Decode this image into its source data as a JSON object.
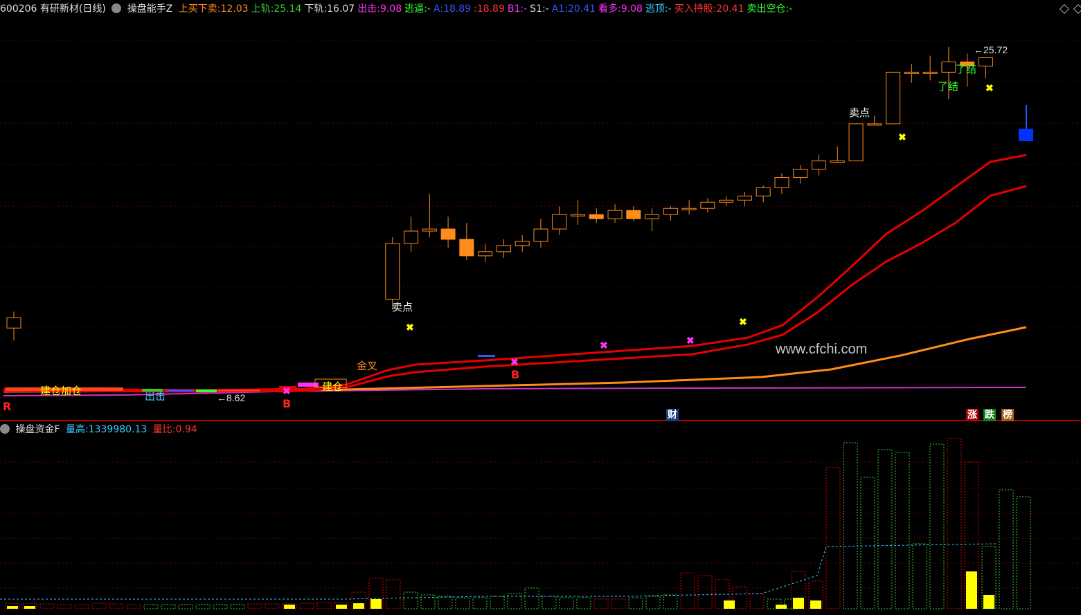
{
  "header": {
    "stock": "600206 有研新材(日线)",
    "indicator": "操盘能手Z",
    "fields": [
      {
        "label": "上买下卖:",
        "value": "12.03",
        "color": "#ff8c1a"
      },
      {
        "label": "上轨:",
        "value": "25.14",
        "color": "#33cc33"
      },
      {
        "label": "下轨:",
        "value": "16.07",
        "color": "#dddddd"
      },
      {
        "label": "出击:",
        "value": "9.08",
        "color": "#ff33ff"
      },
      {
        "label": "逃逼:",
        "value": "-",
        "color": "#33ff33"
      },
      {
        "label": "A:",
        "value": "18.89",
        "color": "#3355ff"
      },
      {
        "label": ":",
        "value": "18.89",
        "color": "#ff3333"
      },
      {
        "label": "B1:",
        "value": "-",
        "color": "#ff33ff"
      },
      {
        "label": "S1:",
        "value": "-",
        "color": "#dddddd"
      },
      {
        "label": "A1:",
        "value": "20.41",
        "color": "#3355ff"
      },
      {
        "label": "看多:",
        "value": "9.08",
        "color": "#ff33ff"
      },
      {
        "label": "逃顶:",
        "value": "-",
        "color": "#33ccff"
      },
      {
        "label": "买入持股:",
        "value": "20.41",
        "color": "#ff3333"
      },
      {
        "label": "卖出空仓:",
        "value": "-",
        "color": "#33ff33"
      }
    ]
  },
  "main_labels": {
    "sell_point_1": "卖点",
    "sell_point_2": "卖点",
    "golden_cross": "金叉",
    "attack": "出击",
    "build_position": "建仓加仓",
    "build_position_2": "建仓",
    "finish_1": "了结",
    "finish_2": "了结",
    "high_price": "25.72",
    "low_price": "8.62",
    "watermark": "www.cfchi.com",
    "b_marker": "B",
    "r_marker": "R"
  },
  "badges": {
    "finance": "财",
    "rise": "涨",
    "fall": "跌",
    "rank": "榜"
  },
  "sub_panel": {
    "indicator": "操盘资金F",
    "vol_high_label": "量高:",
    "vol_high_value": "1339980.13",
    "vol_ratio_label": "量比:",
    "vol_ratio_value": "0.94"
  },
  "colors": {
    "background": "#000000",
    "grid": "#8b0000",
    "up_candle": "#ff8c1a",
    "ma_red": "#e60000",
    "ma_orange": "#ff8c1a",
    "ma_purple": "#cc33cc",
    "vol_red": "#e60000",
    "vol_green": "#33cc33",
    "vol_yellow": "#ffff00"
  },
  "chart_data": {
    "type": "candlestick",
    "price_range": [
      8.62,
      25.72
    ],
    "candles": [
      {
        "o": 12.1,
        "h": 12.9,
        "l": 11.5,
        "c": 12.6
      },
      {
        "o": 13.5,
        "h": 16.5,
        "l": 13.0,
        "c": 16.2
      },
      {
        "o": 16.2,
        "h": 17.5,
        "l": 15.8,
        "c": 16.8
      },
      {
        "o": 16.8,
        "h": 18.6,
        "l": 16.5,
        "c": 16.9
      },
      {
        "o": 16.9,
        "h": 17.5,
        "l": 16.0,
        "c": 16.4
      },
      {
        "o": 16.4,
        "h": 17.2,
        "l": 15.4,
        "c": 15.6
      },
      {
        "o": 15.6,
        "h": 16.2,
        "l": 15.3,
        "c": 15.8
      },
      {
        "o": 15.8,
        "h": 16.4,
        "l": 15.5,
        "c": 16.1
      },
      {
        "o": 16.1,
        "h": 16.6,
        "l": 15.8,
        "c": 16.3
      },
      {
        "o": 16.3,
        "h": 17.4,
        "l": 16.0,
        "c": 16.9
      },
      {
        "o": 16.9,
        "h": 18.0,
        "l": 16.6,
        "c": 17.6
      },
      {
        "o": 17.6,
        "h": 18.3,
        "l": 17.1,
        "c": 17.6
      },
      {
        "o": 17.6,
        "h": 17.9,
        "l": 17.2,
        "c": 17.4
      },
      {
        "o": 17.4,
        "h": 18.1,
        "l": 17.2,
        "c": 17.8
      },
      {
        "o": 17.8,
        "h": 18.0,
        "l": 17.3,
        "c": 17.4
      },
      {
        "o": 17.4,
        "h": 17.9,
        "l": 16.8,
        "c": 17.6
      },
      {
        "o": 17.6,
        "h": 18.0,
        "l": 17.3,
        "c": 17.9
      },
      {
        "o": 17.9,
        "h": 18.3,
        "l": 17.6,
        "c": 17.9
      },
      {
        "o": 17.9,
        "h": 18.4,
        "l": 17.7,
        "c": 18.2
      },
      {
        "o": 18.2,
        "h": 18.5,
        "l": 18.0,
        "c": 18.3
      },
      {
        "o": 18.3,
        "h": 18.7,
        "l": 18.0,
        "c": 18.5
      },
      {
        "o": 18.5,
        "h": 19.0,
        "l": 18.2,
        "c": 18.9
      },
      {
        "o": 18.9,
        "h": 19.6,
        "l": 18.6,
        "c": 19.4
      },
      {
        "o": 19.4,
        "h": 20.0,
        "l": 19.1,
        "c": 19.8
      },
      {
        "o": 19.8,
        "h": 20.5,
        "l": 19.5,
        "c": 20.2
      },
      {
        "o": 20.2,
        "h": 20.9,
        "l": 20.1,
        "c": 20.2
      },
      {
        "o": 20.2,
        "h": 22.0,
        "l": 20.2,
        "c": 22.0
      },
      {
        "o": 22.0,
        "h": 22.4,
        "l": 22.0,
        "c": 22.0
      },
      {
        "o": 22.0,
        "h": 24.5,
        "l": 22.0,
        "c": 24.5
      },
      {
        "o": 24.5,
        "h": 24.9,
        "l": 24.0,
        "c": 24.5
      },
      {
        "o": 24.5,
        "h": 25.3,
        "l": 24.1,
        "c": 24.5
      },
      {
        "o": 24.5,
        "h": 25.72,
        "l": 23.2,
        "c": 25.0
      },
      {
        "o": 25.0,
        "h": 25.4,
        "l": 23.8,
        "c": 24.8
      },
      {
        "o": 24.8,
        "h": 25.2,
        "l": 24.2,
        "c": 25.2
      }
    ]
  }
}
